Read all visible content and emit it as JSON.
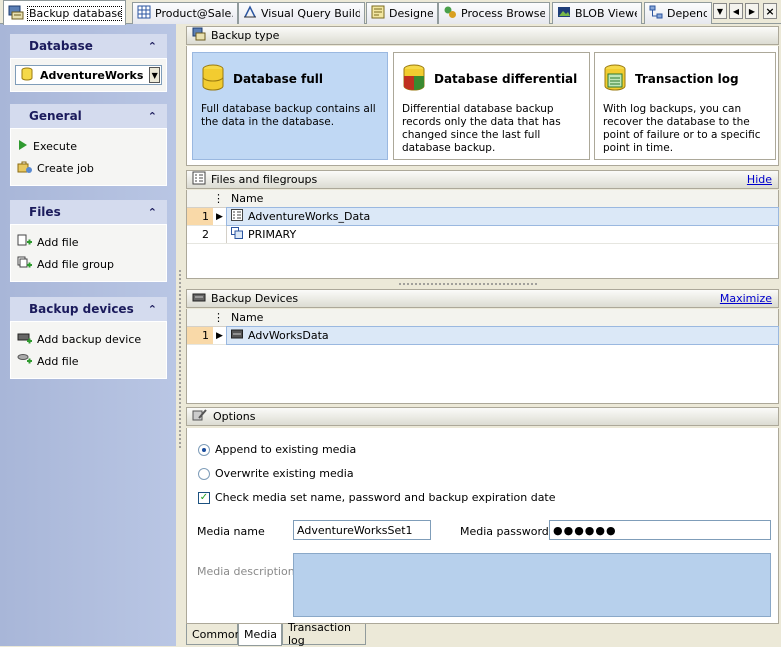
{
  "tabs": [
    {
      "label": "Backup database",
      "icon": "backup-db-icon",
      "active": true
    },
    {
      "label": "Product@Sale...",
      "icon": "table-icon"
    },
    {
      "label": "Visual Query Builder",
      "icon": "query-builder-icon"
    },
    {
      "label": "Designer",
      "icon": "designer-icon"
    },
    {
      "label": "Process Browser",
      "icon": "process-browser-icon"
    },
    {
      "label": "BLOB Viewer",
      "icon": "blob-viewer-icon"
    },
    {
      "label": "Depende",
      "icon": "dependencies-icon"
    }
  ],
  "sidebar": {
    "database": {
      "title": "Database",
      "selected": "AdventureWorks"
    },
    "general": {
      "title": "General",
      "items": [
        {
          "label": "Execute",
          "icon": "play-icon"
        },
        {
          "label": "Create job",
          "icon": "create-job-icon"
        }
      ]
    },
    "files": {
      "title": "Files",
      "items": [
        {
          "label": "Add file",
          "icon": "add-file-icon"
        },
        {
          "label": "Add file group",
          "icon": "add-file-group-icon"
        }
      ]
    },
    "devices": {
      "title": "Backup devices",
      "items": [
        {
          "label": "Add backup device",
          "icon": "add-backup-device-icon"
        },
        {
          "label": "Add file",
          "icon": "add-file-icon"
        }
      ]
    }
  },
  "backup_type": {
    "title": "Backup type",
    "options": [
      {
        "title": "Database full",
        "desc": "Full database backup contains all the data in the database.",
        "selected": true
      },
      {
        "title": "Database differential",
        "desc": "Differential database backup records only the data that has changed since the last full database backup."
      },
      {
        "title": "Transaction log",
        "desc": "With log backups, you can recover the database to the point of failure or to a specific point in time."
      }
    ]
  },
  "files_panel": {
    "title": "Files and filegroups",
    "link": "Hide",
    "column": "Name",
    "rows": [
      {
        "num": "1",
        "name": "AdventureWorks_Data",
        "selected": true
      },
      {
        "num": "2",
        "name": "PRIMARY"
      }
    ]
  },
  "devices_panel": {
    "title": "Backup Devices",
    "link": "Maximize",
    "column": "Name",
    "rows": [
      {
        "num": "1",
        "name": "AdvWorksData",
        "selected": true
      }
    ]
  },
  "options": {
    "title": "Options",
    "append_label": "Append to existing media",
    "overwrite_label": "Overwrite existing media",
    "check_label": "Check media set name, password and backup expiration date",
    "media_name_label": "Media name",
    "media_name_value": "AdventureWorksSet1",
    "media_password_label": "Media password",
    "media_password_value": "●●●●●●",
    "media_desc_label": "Media description"
  },
  "bottom_tabs": [
    "Common",
    "Media",
    "Transaction log"
  ],
  "colors": {
    "accent": "#c0d8f4",
    "link": "#0000cc",
    "sidebar": "#b1bfe0"
  }
}
